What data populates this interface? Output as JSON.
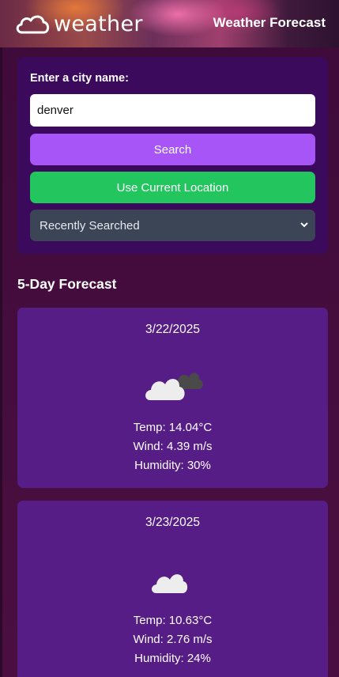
{
  "header": {
    "logo_text": "weather",
    "title": "Weather Forecast"
  },
  "search": {
    "label": "Enter a city name:",
    "input_value": "denver",
    "search_button": "Search",
    "location_button": "Use Current Location",
    "recent_select": "Recently Searched"
  },
  "forecast": {
    "title": "5-Day Forecast",
    "days": [
      {
        "date": "3/22/2025",
        "icon": "broken-clouds-icon",
        "temp": "Temp: 14.04°C",
        "wind": "Wind: 4.39 m/s",
        "humidity": "Humidity: 30%"
      },
      {
        "date": "3/23/2025",
        "icon": "few-clouds-icon",
        "temp": "Temp: 10.63°C",
        "wind": "Wind: 2.76 m/s",
        "humidity": "Humidity: 24%"
      }
    ]
  },
  "colors": {
    "search_button": "#a855f7",
    "location_button": "#22c55e",
    "select_bg": "#3b4556",
    "card_bg": "#571d86",
    "panel_bg": "#3b0a5c"
  }
}
